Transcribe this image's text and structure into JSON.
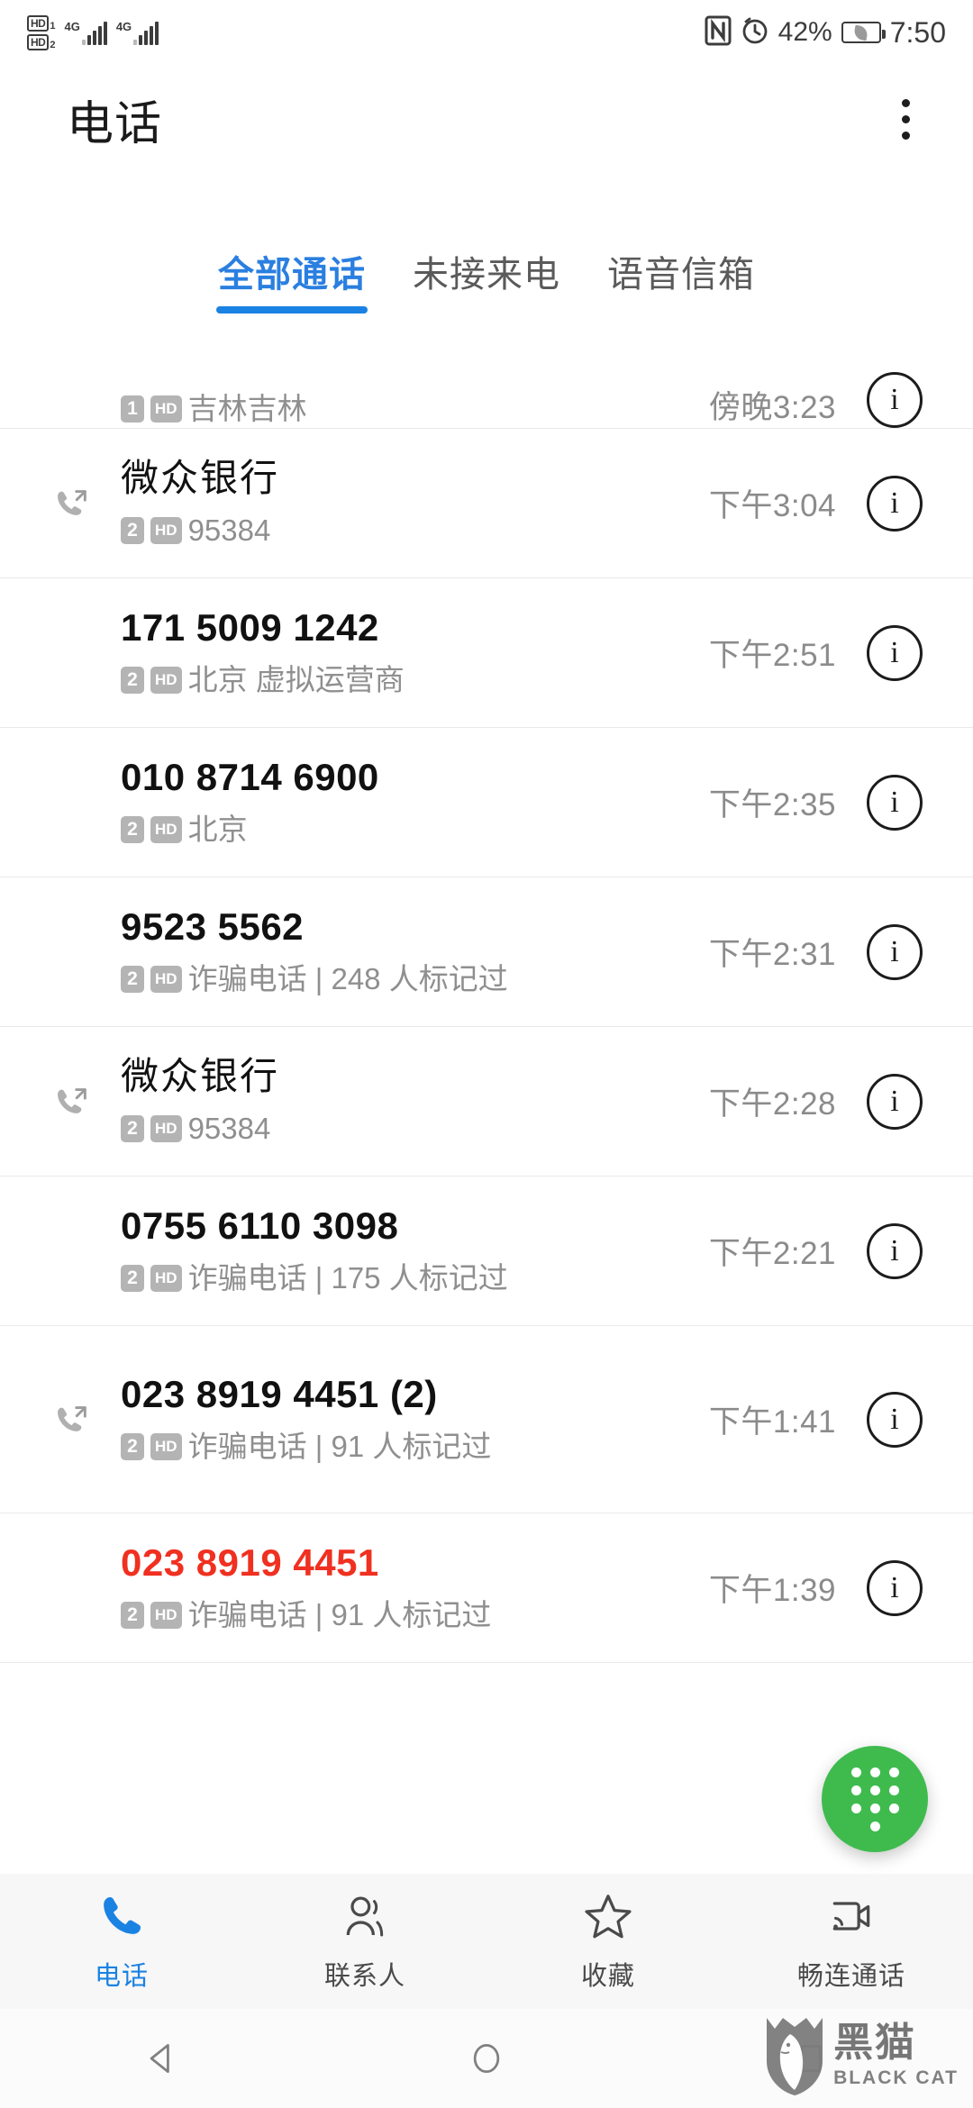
{
  "status_bar": {
    "hd_labels": [
      "HD",
      "HD"
    ],
    "sim_numbers": [
      "1",
      "2"
    ],
    "network_labels": [
      "4G",
      "4G"
    ],
    "nfc_icon": "nfc-icon",
    "alarm_icon": "alarm-icon",
    "battery_percent": "42%",
    "time": "7:50"
  },
  "app_bar": {
    "title": "电话",
    "menu_icon": "kebab-menu-icon"
  },
  "tabs": [
    {
      "label": "全部通话",
      "active": true
    },
    {
      "label": "未接来电",
      "active": false
    },
    {
      "label": "语音信箱",
      "active": false
    }
  ],
  "call_log": [
    {
      "title": "",
      "sim": "1",
      "hd": "HD",
      "subtitle": "吉林吉林",
      "time": "傍晚3:23",
      "direction": "none",
      "missed": false,
      "clipped": true
    },
    {
      "title": "微众银行",
      "sim": "2",
      "hd": "HD",
      "subtitle": "95384",
      "time": "下午3:04",
      "direction": "outgoing",
      "missed": false,
      "clipped": false
    },
    {
      "title": "171 5009 1242",
      "sim": "2",
      "hd": "HD",
      "subtitle": "北京 虚拟运营商",
      "time": "下午2:51",
      "direction": "none",
      "missed": false,
      "clipped": false
    },
    {
      "title": "010 8714 6900",
      "sim": "2",
      "hd": "HD",
      "subtitle": "北京",
      "time": "下午2:35",
      "direction": "none",
      "missed": false,
      "clipped": false
    },
    {
      "title": "9523 5562",
      "sim": "2",
      "hd": "HD",
      "subtitle": "诈骗电话 | 248 人标记过",
      "time": "下午2:31",
      "direction": "none",
      "missed": false,
      "clipped": false
    },
    {
      "title": "微众银行",
      "sim": "2",
      "hd": "HD",
      "subtitle": "95384",
      "time": "下午2:28",
      "direction": "outgoing",
      "missed": false,
      "clipped": false
    },
    {
      "title": "0755 6110 3098",
      "sim": "2",
      "hd": "HD",
      "subtitle": "诈骗电话 | 175 人标记过",
      "time": "下午2:21",
      "direction": "none",
      "missed": false,
      "clipped": false
    },
    {
      "title": "023 8919 4451 (2)",
      "sim": "2",
      "hd": "HD",
      "subtitle": "诈骗电话 | 91 人标记过",
      "time": "下午1:41",
      "direction": "outgoing",
      "missed": false,
      "clipped": false,
      "wrap": true
    },
    {
      "title": "023 8919 4451",
      "sim": "2",
      "hd": "HD",
      "subtitle": "诈骗电话 | 91 人标记过",
      "time": "下午1:39",
      "direction": "none",
      "missed": true,
      "clipped": false
    }
  ],
  "fab": {
    "icon": "dialpad-icon",
    "color": "#3fbb4e"
  },
  "bottom_nav": [
    {
      "label": "电话",
      "icon": "phone-icon",
      "active": true
    },
    {
      "label": "联系人",
      "icon": "contacts-icon",
      "active": false
    },
    {
      "label": "收藏",
      "icon": "star-icon",
      "active": false
    },
    {
      "label": "畅连通话",
      "icon": "video-call-icon",
      "active": false
    }
  ],
  "system_nav": [
    {
      "icon": "back-triangle-icon"
    },
    {
      "icon": "home-circle-icon"
    },
    {
      "icon": "recents-square-icon"
    }
  ],
  "watermark": {
    "cn": "黑猫",
    "en": "BLACK CAT",
    "icon": "black-cat-shield-icon"
  },
  "colors": {
    "accent_blue": "#1a82e2",
    "fab_green": "#3fbb4e",
    "missed_red": "#f03020",
    "badge_gray": "#b4b4b4"
  },
  "info_icon_label": "i"
}
